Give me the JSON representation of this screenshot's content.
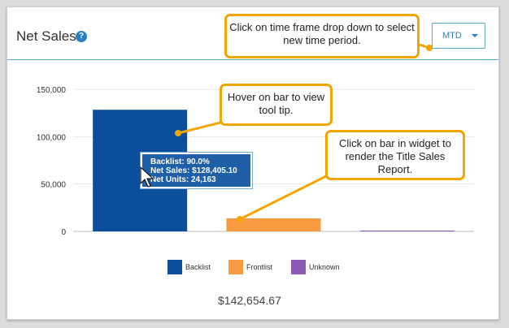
{
  "widget": {
    "title": "Net Sales",
    "help_icon": "help-circle-icon",
    "timeframe": "MTD",
    "total": "$142,654.67"
  },
  "callouts": {
    "timeframe": "Click on time frame drop down to select new time period.",
    "hover": "Hover on bar to view tool tip.",
    "click": "Click on bar in widget to render the Title Sales Report."
  },
  "tooltip": {
    "line1": "Backlist: 90.0%",
    "line2": "Net Sales: $128,405.10",
    "line3": "Net Units: 24,163"
  },
  "colors": {
    "backlist": "#0b4f9c",
    "frontlist": "#f89a3f",
    "unknown": "#8d5bb5",
    "accent": "#2a7fc4",
    "callout_border": "#f0a500"
  },
  "chart_data": {
    "type": "bar",
    "categories": [
      "Backlist",
      "Frontlist",
      "Unknown"
    ],
    "values": [
      128405.1,
      13800,
      500
    ],
    "yticks": [
      "0",
      "50,000",
      "100,000",
      "150,000"
    ],
    "ylim": [
      0,
      150000
    ],
    "grid": true,
    "legend": "bottom",
    "legend_entries": [
      "Backlist",
      "Frontlist",
      "Unknown"
    ]
  }
}
